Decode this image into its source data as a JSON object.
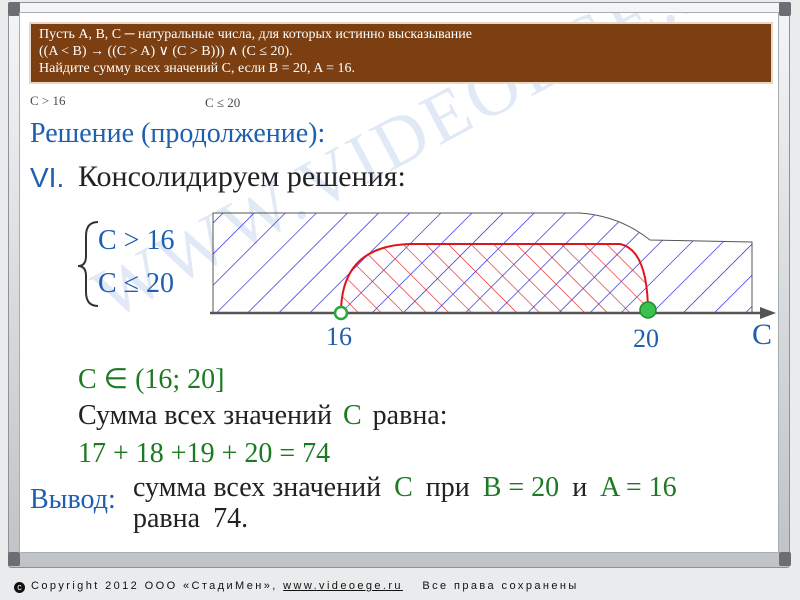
{
  "task": {
    "line1": "Пусть A, B, C ─ натуральные числа, для которых истинно высказывание",
    "line2": "((A < B) → ((C > A) ∨ (C > B))) ∧ (C ≤ 20).",
    "line3": "Найдите сумму всех значений  C,  если B = 20,  A = 16."
  },
  "notes": {
    "left": "C > 16",
    "right": "C ≤ 20"
  },
  "heading": "Решение (продолжение):",
  "step": {
    "number": "VI.",
    "text": "Консолидируем решения:"
  },
  "system": {
    "ineq1": "C > 16",
    "ineq2": "C ≤ 20"
  },
  "axis": {
    "label": "C",
    "point1": "16",
    "point2": "20"
  },
  "result": {
    "interval": "C ∈ (16; 20]",
    "sum_label_a": "Сумма всех значений",
    "sum_label_var": "C",
    "sum_label_b": "равна:",
    "sum_expression": "17 + 18 +19 + 20 = 74"
  },
  "conclusion": {
    "label": "Вывод:",
    "line1_a": "сумма  всех значений",
    "line1_var": "C",
    "line1_b": "при",
    "line1_cond1": "B = 20",
    "line1_and": "и",
    "line1_cond2": "A = 16",
    "line2_a": "равна",
    "line2_value": "74."
  },
  "watermark": "WWW.VIDEOEGE.RU",
  "footer": {
    "copyright": "Copyright 2012 ООО «СтадиМен»,",
    "url": "www.videoege.ru",
    "rights": "Все права сохранены"
  },
  "colors": {
    "task_bg": "#7b3f12",
    "accent_blue": "#1f5fb0",
    "accent_green": "#1b7a22",
    "region_red": "#e0151b",
    "hatch_blue": "#1b1bd6"
  }
}
